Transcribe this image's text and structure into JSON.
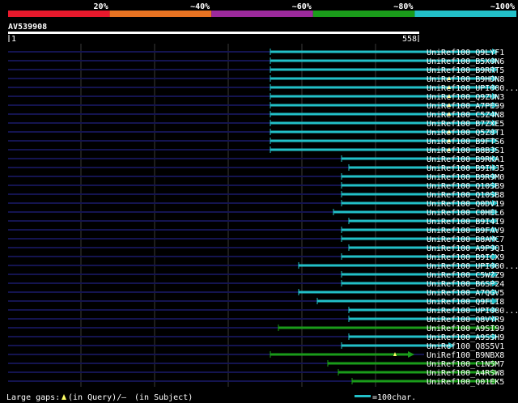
{
  "color_legend": [
    {
      "label": "20%",
      "color": "#e8192c"
    },
    {
      "label": "~40%",
      "color": "#e87322"
    },
    {
      "label": "~60%",
      "color": "#9c2a9c"
    },
    {
      "label": "~80%",
      "color": "#1a9c1a"
    },
    {
      "label": "~100%",
      "color": "#22c0c8"
    }
  ],
  "query": {
    "name": "AV539908",
    "start_label": "1",
    "end_label": "558",
    "length": 558
  },
  "hits": [
    {
      "name": "UniRef100_Q9LYF1",
      "start": 334,
      "end": 616,
      "color": "cyan",
      "gaps": []
    },
    {
      "name": "UniRef100_B5X0N6",
      "start": 334,
      "end": 616,
      "color": "cyan",
      "gaps": []
    },
    {
      "name": "UniRef100_B9RRT5",
      "start": 334,
      "end": 616,
      "color": "cyan",
      "gaps": []
    },
    {
      "name": "UniRef100_B9HDN8",
      "start": 334,
      "end": 616,
      "color": "cyan",
      "gaps": [
        555
      ]
    },
    {
      "name": "UniRef100_UPI000...",
      "start": 334,
      "end": 616,
      "color": "cyan",
      "gaps": [
        555
      ]
    },
    {
      "name": "UniRef100_Q9ZUN3",
      "start": 334,
      "end": 616,
      "color": "cyan",
      "gaps": [
        555
      ]
    },
    {
      "name": "UniRef100_A7PE99",
      "start": 334,
      "end": 616,
      "color": "cyan",
      "gaps": [
        555
      ]
    },
    {
      "name": "UniRef100_C5Z4N8",
      "start": 334,
      "end": 616,
      "color": "cyan",
      "gaps": [
        555
      ]
    },
    {
      "name": "UniRef100_B7ZXE5",
      "start": 334,
      "end": 616,
      "color": "cyan",
      "gaps": []
    },
    {
      "name": "UniRef100_Q5Z8T1",
      "start": 334,
      "end": 616,
      "color": "cyan",
      "gaps": [
        555
      ]
    },
    {
      "name": "UniRef100_B9FTS6",
      "start": 334,
      "end": 616,
      "color": "cyan",
      "gaps": [
        555
      ]
    },
    {
      "name": "UniRef100_B8B3S1",
      "start": 334,
      "end": 616,
      "color": "cyan",
      "gaps": [
        555
      ]
    },
    {
      "name": "UniRef100_B9RKA1",
      "start": 422,
      "end": 616,
      "color": "cyan",
      "gaps": []
    },
    {
      "name": "UniRef100_B9IHJ5",
      "start": 431,
      "end": 616,
      "color": "cyan",
      "gaps": []
    },
    {
      "name": "UniRef100_B9R9M0",
      "start": 422,
      "end": 616,
      "color": "cyan",
      "gaps": []
    },
    {
      "name": "UniRef100_Q10SB9",
      "start": 422,
      "end": 616,
      "color": "cyan",
      "gaps": []
    },
    {
      "name": "UniRef100_Q10SB8",
      "start": 422,
      "end": 616,
      "color": "cyan",
      "gaps": []
    },
    {
      "name": "UniRef100_Q0DV19",
      "start": 422,
      "end": 616,
      "color": "cyan",
      "gaps": []
    },
    {
      "name": "UniRef100_C0HEL6",
      "start": 412,
      "end": 616,
      "color": "cyan",
      "gaps": []
    },
    {
      "name": "UniRef100_B9I4I9",
      "start": 431,
      "end": 616,
      "color": "cyan",
      "gaps": []
    },
    {
      "name": "UniRef100_B9FAV9",
      "start": 422,
      "end": 616,
      "color": "cyan",
      "gaps": []
    },
    {
      "name": "UniRef100_B8AMC7",
      "start": 422,
      "end": 616,
      "color": "cyan",
      "gaps": []
    },
    {
      "name": "UniRef100_A9P9Q1",
      "start": 431,
      "end": 616,
      "color": "cyan",
      "gaps": []
    },
    {
      "name": "UniRef100_B9ICX9",
      "start": 422,
      "end": 616,
      "color": "cyan",
      "gaps": []
    },
    {
      "name": "UniRef100_UPI000...",
      "start": 369,
      "end": 616,
      "color": "cyan",
      "gaps": []
    },
    {
      "name": "UniRef100_C5WZZ9",
      "start": 422,
      "end": 616,
      "color": "cyan",
      "gaps": []
    },
    {
      "name": "UniRef100_B6SP24",
      "start": 422,
      "end": 616,
      "color": "cyan",
      "gaps": []
    },
    {
      "name": "UniRef100_A7QGV5",
      "start": 369,
      "end": 616,
      "color": "cyan",
      "gaps": []
    },
    {
      "name": "UniRef100_Q9FLI8",
      "start": 392,
      "end": 616,
      "color": "cyan",
      "gaps": []
    },
    {
      "name": "UniRef100_UPI000...",
      "start": 431,
      "end": 616,
      "color": "cyan",
      "gaps": []
    },
    {
      "name": "UniRef100_Q8VYR9",
      "start": 431,
      "end": 616,
      "color": "cyan",
      "gaps": []
    },
    {
      "name": "UniRef100_A9SI99",
      "start": 344,
      "end": 616,
      "color": "green",
      "gaps": []
    },
    {
      "name": "UniRef100_A9SSH9",
      "start": 431,
      "end": 616,
      "color": "cyan",
      "gaps": []
    },
    {
      "name": "UniRef100_Q8S5V1",
      "start": 422,
      "end": 562,
      "color": "cyan",
      "gaps": []
    },
    {
      "name": "UniRef100_B9NBX8",
      "start": 334,
      "end": 512,
      "color": "green",
      "gaps": [
        488
      ]
    },
    {
      "name": "UniRef100_C1N5M7",
      "start": 405,
      "end": 616,
      "color": "green",
      "gaps": []
    },
    {
      "name": "UniRef100_A4RSW8",
      "start": 418,
      "end": 616,
      "color": "green",
      "gaps": []
    },
    {
      "name": "UniRef100_Q01EK5",
      "start": 435,
      "end": 616,
      "color": "green",
      "gaps": []
    }
  ],
  "footer": {
    "gaps_text": "Large gaps:",
    "query_gap_text": "(in Query)/",
    "subject_gap_marker": "—",
    "subject_gap_text": "(in Subject)",
    "scale_text": "=100char."
  }
}
